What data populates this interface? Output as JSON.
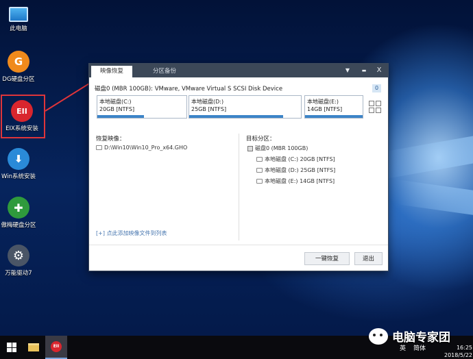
{
  "desktop": {
    "icons": [
      {
        "label": "此电脑",
        "icon": "computer-icon"
      },
      {
        "label": "DG硬盘分区",
        "icon": "dg-partition-icon",
        "glyph": "G"
      },
      {
        "label": "EIX系统安装",
        "icon": "eix-install-icon",
        "glyph": "EII"
      },
      {
        "label": "Win系统安装",
        "icon": "win-install-icon",
        "glyph": "⬇"
      },
      {
        "label": "傲梅硬盘分区",
        "icon": "aomei-partition-icon",
        "glyph": "✚"
      },
      {
        "label": "万能驱动7",
        "icon": "driver-gear-icon",
        "glyph": "⚙"
      }
    ]
  },
  "dialog": {
    "tabs": [
      {
        "label": "映像恢复",
        "active": true
      },
      {
        "label": "分区备份",
        "active": false
      }
    ],
    "window_buttons": {
      "dropdown": "▼",
      "minimize": "▬",
      "close": "X"
    },
    "disk_title": "磁盘0 (MBR 100GB): VMware, VMware Virtual S SCSI Disk Device",
    "disk_badge": "0",
    "partitions": [
      {
        "name": "本地磁盘(C:)",
        "info": "20GB [NTFS]",
        "used_fraction": 0.52
      },
      {
        "name": "本地磁盘(D:)",
        "info": "25GB [NTFS]",
        "used_fraction": 0.84
      },
      {
        "name": "本地磁盘(E:)",
        "info": "14GB [NTFS]",
        "used_fraction": 1.0
      }
    ],
    "restore_image_title": "恢复映像：",
    "image_file": "D:\\Win10\\Win10_Pro_x64.GHO",
    "target_title": "目标分区：",
    "target_disk": "磁盘0 (MBR 100GB)",
    "target_partitions": [
      "本地磁盘 (C:) 20GB [NTFS]",
      "本地磁盘 (D:) 25GB [NTFS]",
      "本地磁盘 (E:) 14GB [NTFS]"
    ],
    "add_link": "[+] 点此添加映像文件到列表",
    "restore_button": "一键恢复",
    "exit_button": "退出"
  },
  "taskbar": {
    "tray_lang": "英",
    "tray_ime": "简体"
  },
  "watermark": "电脑专家团",
  "clock": {
    "time": "16:25",
    "date": "2018/5/22"
  }
}
